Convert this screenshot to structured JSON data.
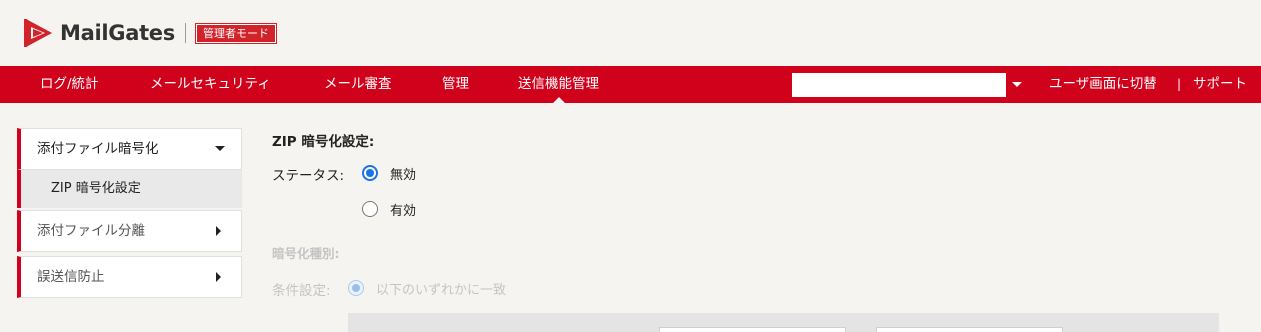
{
  "header": {
    "brand": "MailGates",
    "mode_badge": "管理者モード"
  },
  "nav": {
    "items": [
      {
        "label": "ログ/統計"
      },
      {
        "label": "メールセキュリティ"
      },
      {
        "label": "メール審査"
      },
      {
        "label": "管理"
      },
      {
        "label": "送信機能管理",
        "active": true
      }
    ],
    "search_value": "",
    "switch_user_label": "ユーザ画面に切替",
    "separator": "|",
    "support_label": "サポート"
  },
  "sidebar": {
    "items": [
      {
        "label": "添付ファイル暗号化",
        "expanded": true,
        "children": [
          {
            "label": "ZIP 暗号化設定",
            "selected": true
          }
        ]
      },
      {
        "label": "添付ファイル分離",
        "expanded": false
      },
      {
        "label": "誤送信防止",
        "expanded": false
      }
    ]
  },
  "main": {
    "title": "ZIP 暗号化設定:",
    "status_label": "ステータス:",
    "status_options": [
      {
        "label": "無効",
        "checked": true
      },
      {
        "label": "有効",
        "checked": false
      }
    ],
    "encryption_type_label": "暗号化種別:",
    "condition_label": "条件設定:",
    "condition_option": {
      "label": "以下のいずれかに一致",
      "checked": true,
      "disabled": true
    }
  },
  "colors": {
    "accent": "#d0011b",
    "radio": "#1a73e8",
    "background": "#f5f4f1"
  }
}
